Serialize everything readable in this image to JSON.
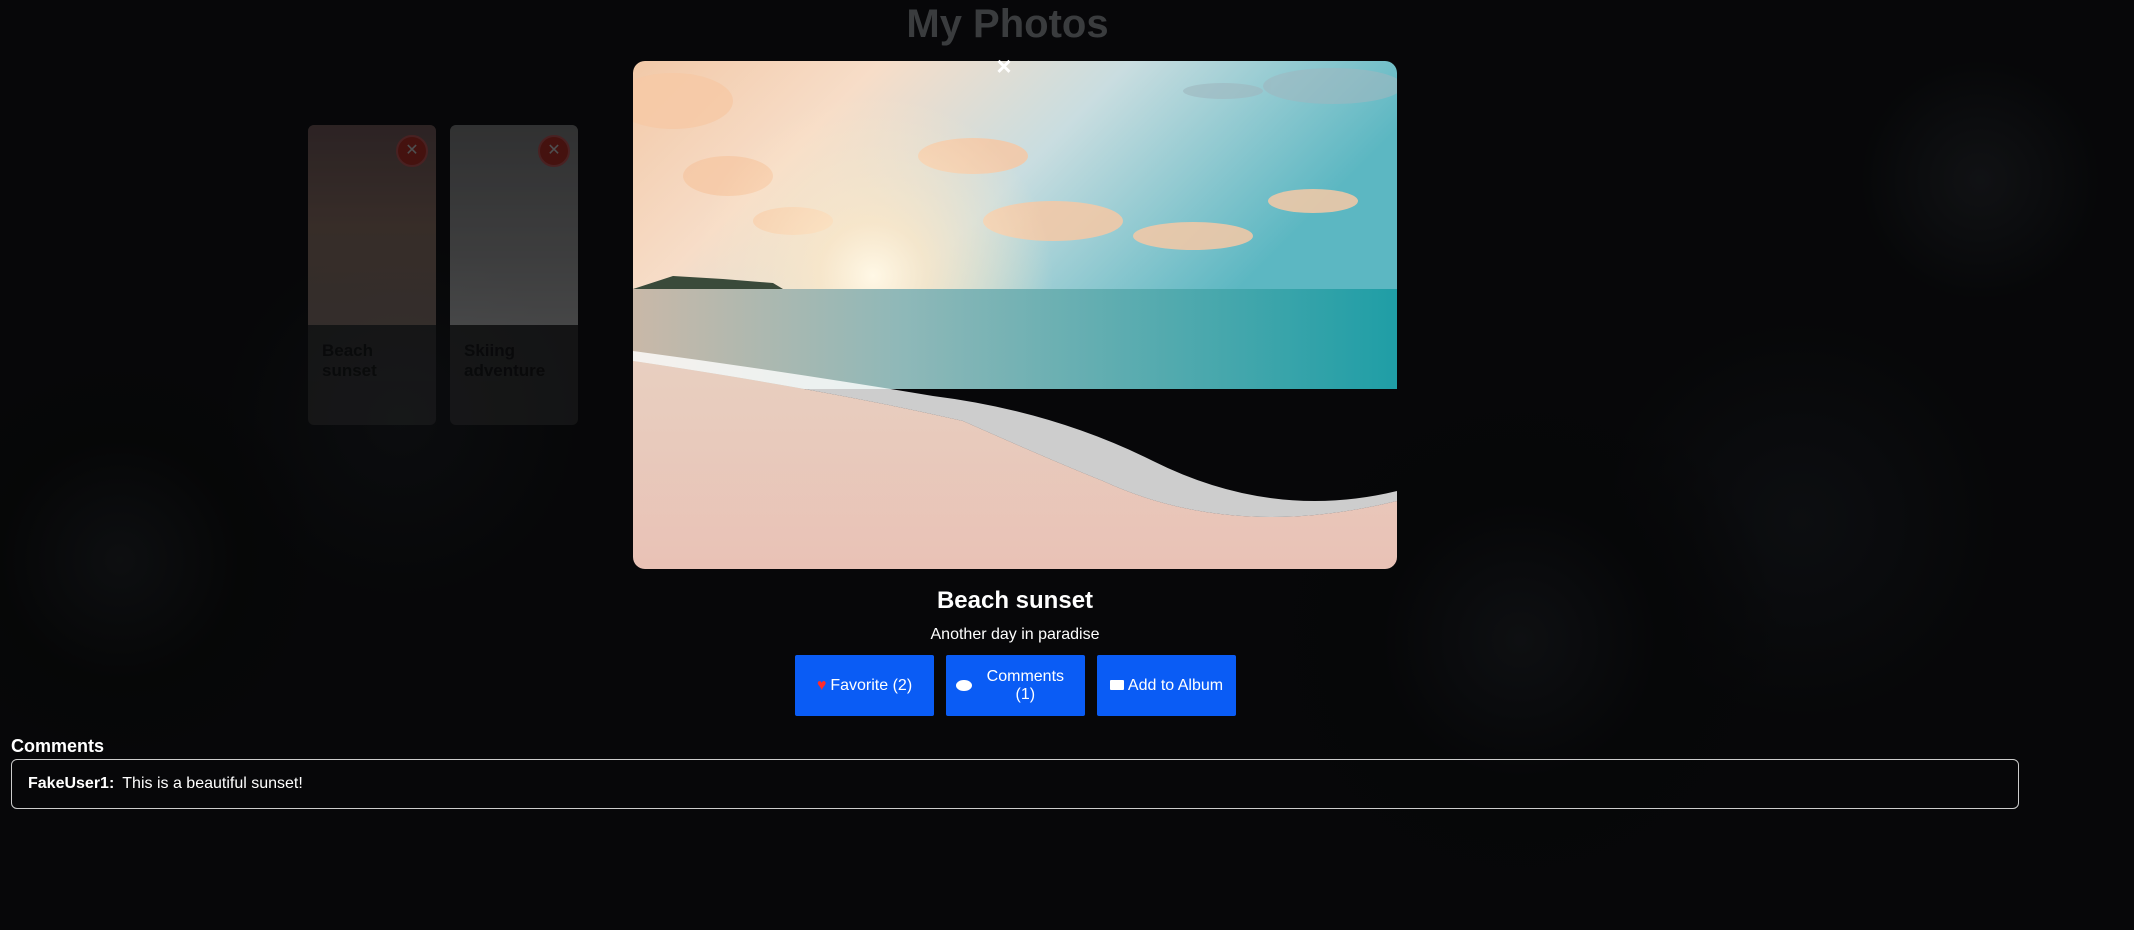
{
  "page": {
    "title": "My Photos"
  },
  "gallery": {
    "cards": [
      {
        "title": "Beach sunset",
        "delete_icon": "x-circle-icon"
      },
      {
        "title": "Skiing adventure",
        "delete_icon": "x-circle-icon"
      }
    ]
  },
  "modal": {
    "close_label": "×",
    "title": "Beach sunset",
    "description": "Another day in paradise",
    "buttons": {
      "favorite": "Favorite (2)",
      "comments": "Comments (1)",
      "add_album": "Add to Album"
    },
    "icons": {
      "favorite": "heart-icon",
      "comments": "speech-bubble-icon",
      "add_album": "folder-icon"
    }
  },
  "comments": {
    "heading": "Comments",
    "items": [
      {
        "user": "FakeUser1:",
        "text": "This is a beautiful sunset!"
      }
    ]
  },
  "colors": {
    "button": "#0a5cf5",
    "heart": "#ff2a2a"
  }
}
